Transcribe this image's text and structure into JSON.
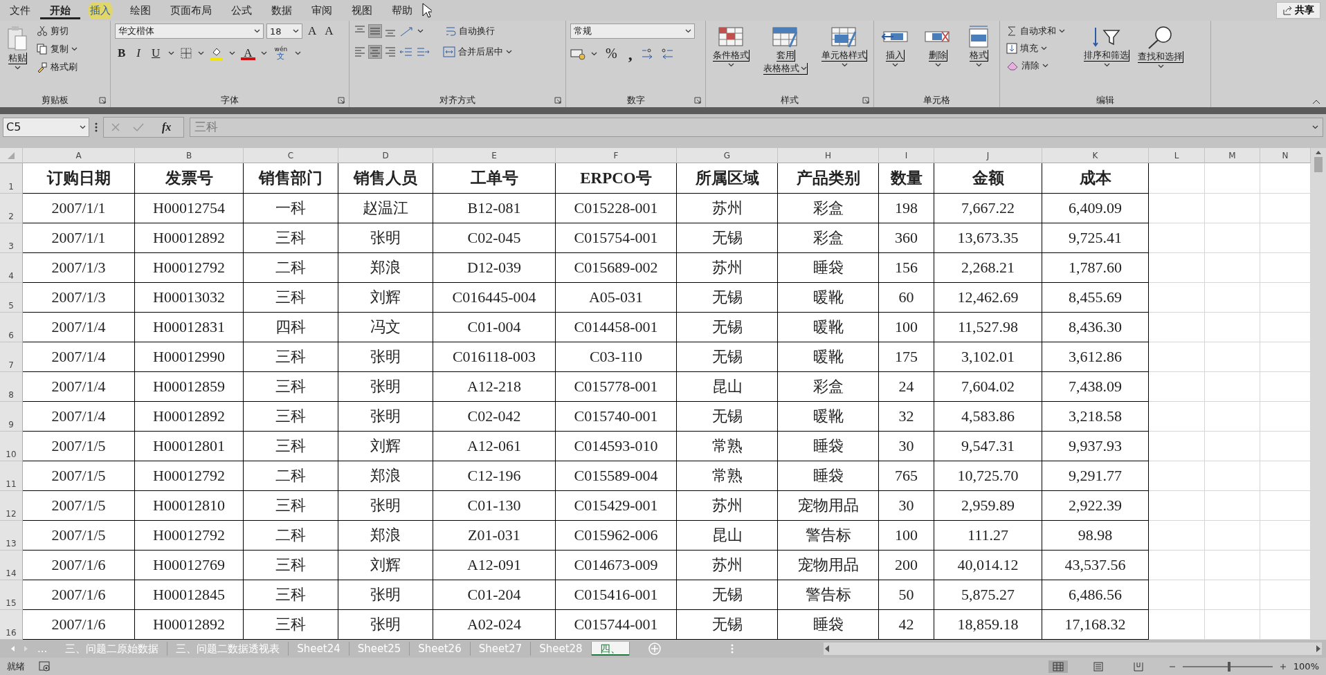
{
  "menu_tabs": [
    {
      "label": "文件",
      "selected": false,
      "hovered": false
    },
    {
      "label": "开始",
      "selected": true,
      "hovered": false
    },
    {
      "label": "插入",
      "selected": false,
      "hovered": true
    },
    {
      "label": "绘图",
      "selected": false,
      "hovered": false
    },
    {
      "label": "页面布局",
      "selected": false,
      "hovered": false
    },
    {
      "label": "公式",
      "selected": false,
      "hovered": false
    },
    {
      "label": "数据",
      "selected": false,
      "hovered": false
    },
    {
      "label": "审阅",
      "selected": false,
      "hovered": false
    },
    {
      "label": "视图",
      "selected": false,
      "hovered": false
    },
    {
      "label": "帮助",
      "selected": false,
      "hovered": false
    }
  ],
  "share_button": "共享",
  "ribbon": [
    {
      "kind": "clipboard",
      "label": "剪贴板",
      "launcher": true,
      "paste": "粘贴",
      "items": [
        "剪切",
        "复制",
        "格式刷"
      ]
    },
    {
      "kind": "font",
      "label": "字体",
      "launcher": true,
      "font": "华文楷体",
      "size": "18",
      "grow": "A",
      "shrink": "A",
      "styles": [
        "B",
        "I",
        "U"
      ],
      "color_letter": "A",
      "phonetic": [
        "wén",
        "文"
      ]
    },
    {
      "kind": "alignment",
      "label": "对齐方式",
      "launcher": true,
      "vertical": [
        {
          "selected": false
        },
        {
          "selected": true
        },
        {
          "selected": false
        }
      ],
      "horizontal": [
        {
          "selected": false
        },
        {
          "selected": true
        },
        {
          "selected": false
        }
      ],
      "wrap": "自动换行",
      "merge": "合并后居中"
    },
    {
      "kind": "number",
      "label": "数字",
      "launcher": true,
      "format": "常规",
      "percent": "%",
      "comma": ","
    },
    {
      "kind": "styles",
      "label": "样式",
      "launcher": true,
      "buttons": [
        [
          "条件格式"
        ],
        [
          "套用",
          "表格格式"
        ],
        [
          "单元格样式"
        ]
      ]
    },
    {
      "kind": "cells",
      "label": "单元格",
      "launcher": false,
      "buttons": [
        "插入",
        "删除",
        "格式"
      ]
    },
    {
      "kind": "editing",
      "label": "编辑",
      "launcher": false,
      "small": [
        "自动求和",
        "填充",
        "清除"
      ],
      "buttons": [
        "排序和筛选",
        "查找和选择"
      ]
    }
  ],
  "formula_bar": {
    "name_box": "C5",
    "fx": "fx",
    "value": "三科"
  },
  "columns": [
    "A",
    "B",
    "C",
    "D",
    "E",
    "F",
    "G",
    "H",
    "I",
    "J",
    "K",
    "L",
    "M",
    "N"
  ],
  "rows": [
    {
      "number": "1",
      "cells": [
        "订购日期",
        "发票号",
        "销售部门",
        "销售人员",
        "工单号",
        "ERPCO号",
        "所属区域",
        "产品类别",
        "数量",
        "金额",
        "成本"
      ]
    },
    {
      "number": "2",
      "cells": [
        "2007/1/1",
        "H00012754",
        "一科",
        "赵温江",
        "B12-081",
        "C015228-001",
        "苏州",
        "彩盒",
        "198",
        "7,667.22",
        "6,409.09"
      ]
    },
    {
      "number": "3",
      "cells": [
        "2007/1/1",
        "H00012892",
        "三科",
        "张明",
        "C02-045",
        "C015754-001",
        "无锡",
        "彩盒",
        "360",
        "13,673.35",
        "9,725.41"
      ]
    },
    {
      "number": "4",
      "cells": [
        "2007/1/3",
        "H00012792",
        "二科",
        "郑浪",
        "D12-039",
        "C015689-002",
        "苏州",
        "睡袋",
        "156",
        "2,268.21",
        "1,787.60"
      ]
    },
    {
      "number": "5",
      "cells": [
        "2007/1/3",
        "H00013032",
        "三科",
        "刘辉",
        "C016445-004",
        "A05-031",
        "无锡",
        "暖靴",
        "60",
        "12,462.69",
        "8,455.69"
      ]
    },
    {
      "number": "6",
      "cells": [
        "2007/1/4",
        "H00012831",
        "四科",
        "冯文",
        "C01-004",
        "C014458-001",
        "无锡",
        "暖靴",
        "100",
        "11,527.98",
        "8,436.30"
      ]
    },
    {
      "number": "7",
      "cells": [
        "2007/1/4",
        "H00012990",
        "三科",
        "张明",
        "C016118-003",
        "C03-110",
        "无锡",
        "暖靴",
        "175",
        "3,102.01",
        "3,612.86"
      ]
    },
    {
      "number": "8",
      "cells": [
        "2007/1/4",
        "H00012859",
        "三科",
        "张明",
        "A12-218",
        "C015778-001",
        "昆山",
        "彩盒",
        "24",
        "7,604.02",
        "7,438.09"
      ]
    },
    {
      "number": "9",
      "cells": [
        "2007/1/4",
        "H00012892",
        "三科",
        "张明",
        "C02-042",
        "C015740-001",
        "无锡",
        "暖靴",
        "32",
        "4,583.86",
        "3,218.58"
      ]
    },
    {
      "number": "10",
      "cells": [
        "2007/1/5",
        "H00012801",
        "三科",
        "刘辉",
        "A12-061",
        "C014593-010",
        "常熟",
        "睡袋",
        "30",
        "9,547.31",
        "9,937.93"
      ]
    },
    {
      "number": "11",
      "cells": [
        "2007/1/5",
        "H00012792",
        "二科",
        "郑浪",
        "C12-196",
        "C015589-004",
        "常熟",
        "睡袋",
        "765",
        "10,725.70",
        "9,291.77"
      ]
    },
    {
      "number": "12",
      "cells": [
        "2007/1/5",
        "H00012810",
        "三科",
        "张明",
        "C01-130",
        "C015429-001",
        "苏州",
        "宠物用品",
        "30",
        "2,959.89",
        "2,922.39"
      ]
    },
    {
      "number": "13",
      "cells": [
        "2007/1/5",
        "H00012792",
        "二科",
        "郑浪",
        "Z01-031",
        "C015962-006",
        "昆山",
        "警告标",
        "100",
        "111.27",
        "98.98"
      ]
    },
    {
      "number": "14",
      "cells": [
        "2007/1/6",
        "H00012769",
        "三科",
        "刘辉",
        "A12-091",
        "C014673-009",
        "苏州",
        "宠物用品",
        "200",
        "40,014.12",
        "43,537.56"
      ]
    },
    {
      "number": "15",
      "cells": [
        "2007/1/6",
        "H00012845",
        "三科",
        "张明",
        "C01-204",
        "C015416-001",
        "无锡",
        "警告标",
        "50",
        "5,875.27",
        "6,486.56"
      ]
    },
    {
      "number": "16",
      "cells": [
        "2007/1/6",
        "H00012892",
        "三科",
        "张明",
        "A02-024",
        "C015744-001",
        "无锡",
        "睡袋",
        "42",
        "18,859.18",
        "17,168.32"
      ]
    }
  ],
  "sheet_tabs": {
    "more": "...",
    "tabs": [
      {
        "label": "三、问题二原始数据",
        "selected": false
      },
      {
        "label": "三、问题二数据透视表",
        "selected": false
      },
      {
        "label": "Sheet24",
        "selected": false
      },
      {
        "label": "Sheet25",
        "selected": false
      },
      {
        "label": "Sheet26",
        "selected": false
      },
      {
        "label": "Sheet27",
        "selected": false
      },
      {
        "label": "Sheet28",
        "selected": false
      },
      {
        "label": "四、",
        "selected": true
      }
    ]
  },
  "status_bar": {
    "text": "就绪",
    "views": [
      {
        "selected": true
      },
      {
        "selected": false
      },
      {
        "selected": false
      }
    ],
    "zoom": {
      "level": 0.5,
      "reading": "100%"
    }
  }
}
